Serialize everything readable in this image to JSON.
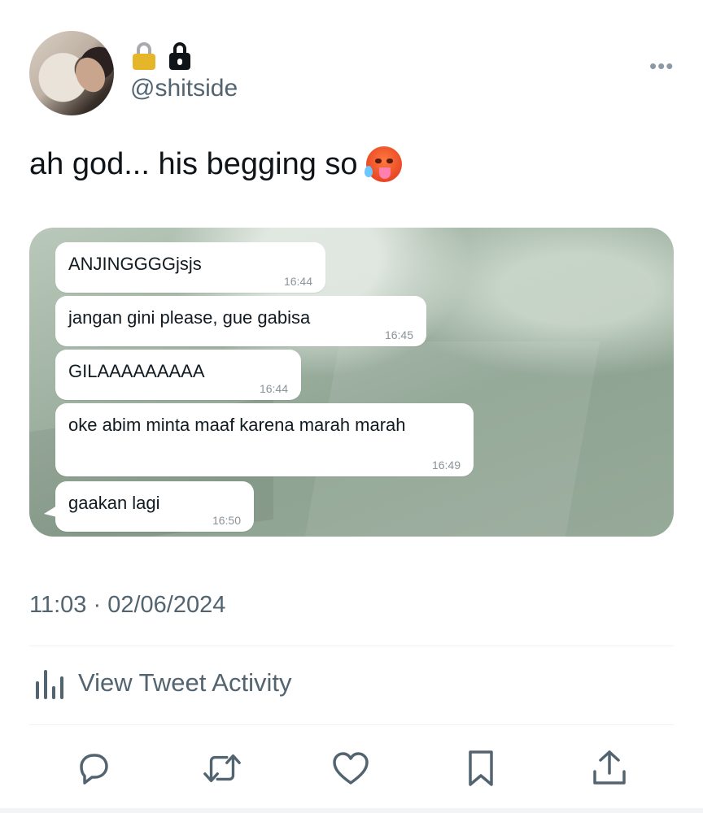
{
  "author": {
    "handle": "@shitside",
    "avatar_icon": "avatar-photo",
    "badges": [
      "lock-emoji-icon",
      "lock-icon"
    ]
  },
  "tweet": {
    "text": "ah god... his begging so",
    "emoji_icon": "hot-face-emoji-icon",
    "timestamp": "11:03 · 02/06/2024"
  },
  "chat_screenshot": {
    "messages": [
      {
        "text": "ANJINGGGGjsjs",
        "time": "16:44"
      },
      {
        "text": "jangan gini please, gue gabisa",
        "time": "16:45"
      },
      {
        "text": "GILAAAAAAAAA",
        "time": "16:44"
      },
      {
        "text": "oke abim minta maaf karena marah marah",
        "time": "16:49"
      },
      {
        "text": "gaakan lagi",
        "time": "16:50"
      }
    ]
  },
  "activity": {
    "label": "View Tweet Activity",
    "icon": "bar-chart-icon"
  },
  "actions": [
    {
      "name": "reply",
      "icon": "reply-icon"
    },
    {
      "name": "retweet",
      "icon": "retweet-icon"
    },
    {
      "name": "like",
      "icon": "heart-icon"
    },
    {
      "name": "bookmark",
      "icon": "bookmark-icon"
    },
    {
      "name": "share",
      "icon": "share-icon"
    }
  ],
  "colors": {
    "text_primary": "#0f1419",
    "text_secondary": "#536471",
    "icon_gray": "#536471",
    "divider": "#eff3f4",
    "chat_bubble": "#ffffff",
    "chat_bg": "#9fb2a2"
  }
}
